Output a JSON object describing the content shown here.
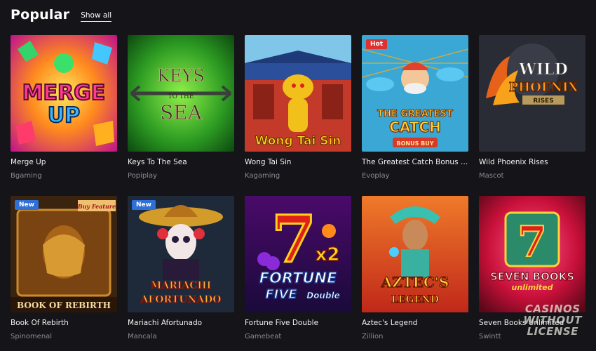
{
  "section": {
    "title": "Popular",
    "show_all_label": "Show all"
  },
  "games": [
    {
      "name": "Merge Up",
      "provider": "Bgaming",
      "art_text": [
        "MERGE",
        "UP"
      ],
      "badge": ""
    },
    {
      "name": "Keys To The Sea",
      "provider": "Popiplay",
      "art_text": [
        "KEYS",
        "TO THE",
        "SEA"
      ],
      "badge": ""
    },
    {
      "name": "Wong Tai Sin",
      "provider": "Kagaming",
      "art_text": [
        "Wong Tai Sin"
      ],
      "badge": ""
    },
    {
      "name": "The Greatest Catch Bonus Buy",
      "provider": "Evoplay",
      "art_text": [
        "THE GREATEST",
        "CATCH",
        "BONUS BUY"
      ],
      "badge": "Hot"
    },
    {
      "name": "Wild Phoenix Rises",
      "provider": "Mascot",
      "art_text": [
        "WILD",
        "PHOENIX",
        "RISES"
      ],
      "badge": ""
    },
    {
      "name": "Book Of Rebirth",
      "provider": "Spinomenal",
      "art_text": [
        "BOOK OF REBIRTH",
        "Buy Feature"
      ],
      "badge": "New"
    },
    {
      "name": "Mariachi Afortunado",
      "provider": "Mancala",
      "art_text": [
        "MARIACHI",
        "AFORTUNADO"
      ],
      "badge": "New"
    },
    {
      "name": "Fortune Five Double",
      "provider": "Gamebeat",
      "art_text": [
        "7",
        "x2",
        "FORTUNE",
        "FIVE",
        "Double"
      ],
      "badge": ""
    },
    {
      "name": "Aztec's Legend",
      "provider": "Zillion",
      "art_text": [
        "AZTEC'S",
        "LEGEND"
      ],
      "badge": ""
    },
    {
      "name": "Seven Books Unlimited",
      "provider": "Swintt",
      "art_text": [
        "SEVEN BOOKS",
        "unlimited"
      ],
      "badge": ""
    }
  ],
  "watermark": [
    "CASINOS",
    "WITHOUT",
    "LICENSE"
  ],
  "colors": {
    "background": "#141419",
    "hot_badge": "#e0312e",
    "new_badge": "#2f6fd8",
    "provider_text": "#8a8a93"
  }
}
